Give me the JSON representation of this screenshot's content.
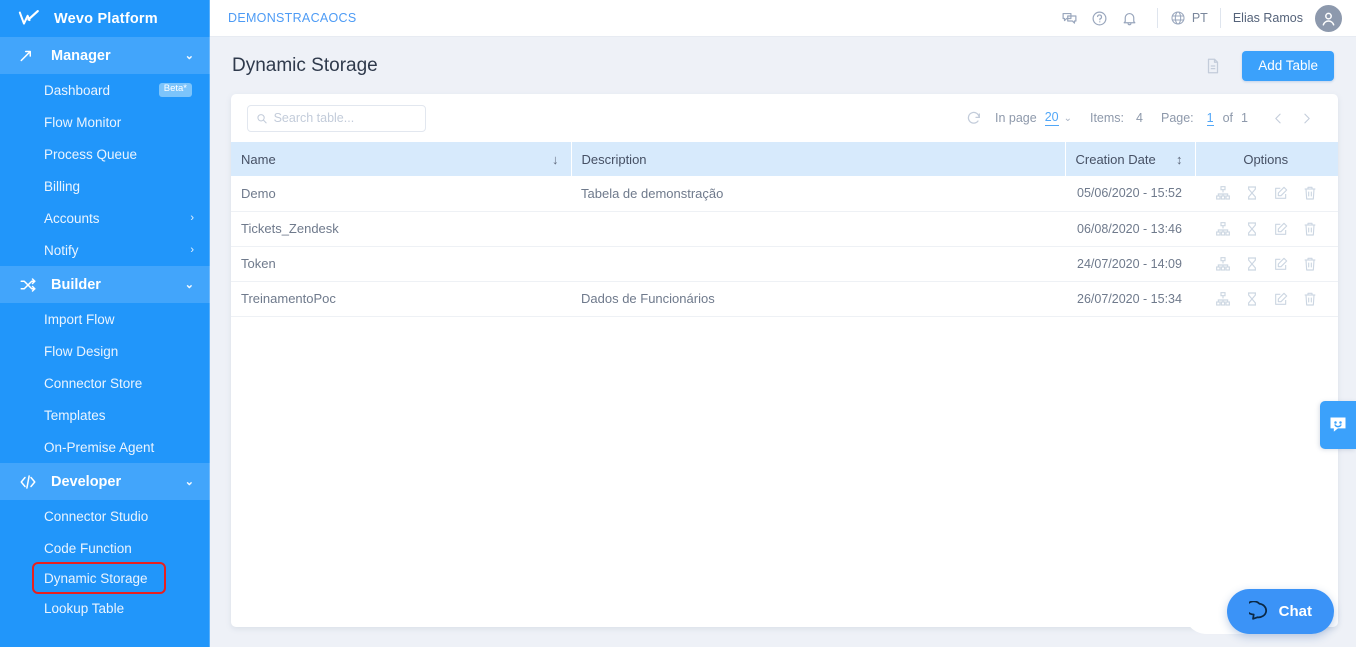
{
  "sidebar": {
    "brand": {
      "logo_icon": "wevo-check-logo",
      "name": "Wevo Platform"
    },
    "groups": [
      {
        "label": "Manager",
        "icon": "trending-up-icon",
        "caret": "⌄",
        "items": [
          {
            "label": "Dashboard",
            "badge": "Beta*"
          },
          {
            "label": "Flow Monitor"
          },
          {
            "label": "Process Queue"
          },
          {
            "label": "Billing"
          },
          {
            "label": "Accounts",
            "caret": "›"
          },
          {
            "label": "Notify",
            "caret": "›"
          }
        ]
      },
      {
        "label": "Builder",
        "icon": "shuffle-icon",
        "caret": "⌄",
        "items": [
          {
            "label": "Import Flow"
          },
          {
            "label": "Flow Design"
          },
          {
            "label": "Connector Store"
          },
          {
            "label": "Templates"
          },
          {
            "label": "On-Premise Agent"
          }
        ]
      },
      {
        "label": "Developer",
        "icon": "code-icon",
        "caret": "⌄",
        "items": [
          {
            "label": "Connector Studio"
          },
          {
            "label": "Code Function"
          },
          {
            "label": "Dynamic Storage",
            "highlighted": true
          },
          {
            "label": "Lookup Table"
          }
        ]
      }
    ]
  },
  "topbar": {
    "breadcrumb": "DEMONSTRACAOCS",
    "icons": [
      "chat-bubbles-icon",
      "help-circle-icon",
      "bell-icon"
    ],
    "language": {
      "icon": "globe-icon",
      "label": "PT"
    },
    "user_name": "Elias Ramos",
    "avatar_icon": "user-avatar-icon"
  },
  "page": {
    "title": "Dynamic Storage",
    "doc_icon": "document-icon",
    "add_table_label": "Add Table"
  },
  "toolbar": {
    "search_placeholder": "Search table...",
    "search_value": "",
    "search_icon": "search-icon",
    "refresh_icon": "refresh-icon",
    "in_page_label": "In page",
    "page_size": "20",
    "page_size_caret": "⌄",
    "items_label": "Items:",
    "items_count": "4",
    "page_label": "Page:",
    "page_current": "1",
    "of_label": "of",
    "page_total": "1",
    "prev_icon": "chevron-left-icon",
    "next_icon": "chevron-right-icon"
  },
  "table": {
    "columns": [
      {
        "label": "Name",
        "sort": "↓"
      },
      {
        "label": "Description",
        "sort": ""
      },
      {
        "label": "Creation Date",
        "sort": "↕"
      },
      {
        "label": "Options",
        "sort": ""
      }
    ],
    "row_action_icons": [
      "hierarchy-icon",
      "hourglass-icon",
      "edit-icon",
      "delete-icon"
    ],
    "rows": [
      {
        "name": "Demo",
        "description": "Tabela de demonstração",
        "created": "05/06/2020 - 15:52"
      },
      {
        "name": "Tickets_Zendesk",
        "description": "",
        "created": "06/08/2020 - 13:46"
      },
      {
        "name": "Token",
        "description": "",
        "created": "24/07/2020 - 14:09"
      },
      {
        "name": "TreinamentoPoc",
        "description": "Dados de Funcionários",
        "created": "26/07/2020 - 15:34"
      }
    ]
  },
  "widgets": {
    "chat_tab_icon": "smiley-chat-icon",
    "chat_fab_icon": "chat-bubble-icon",
    "chat_fab_label": "Chat"
  },
  "colors": {
    "sidebar_blue": "#2196fa",
    "sidebar_group_blue": "#42a5fb",
    "accent_blue": "#3ba1fb",
    "link_blue": "#4d9bf5",
    "table_header_blue": "#d7eafc",
    "highlight_red": "#e8201f",
    "page_bg": "#eef1f7"
  }
}
